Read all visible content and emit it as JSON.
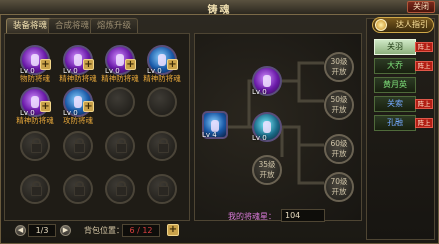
{
  "window": {
    "title": "铸魂",
    "close_label": "关闭"
  },
  "tabs": [
    "装备将魂",
    "合成将魂",
    "熔炼升级"
  ],
  "inventory": {
    "orbs": [
      {
        "level": "Lv 0",
        "label": "物防将魂",
        "color": "purple"
      },
      {
        "level": "Lv 0",
        "label": "精神防将魂",
        "color": "purple"
      },
      {
        "level": "Lv 0",
        "label": "精神防将魂",
        "color": "purple"
      },
      {
        "level": "Lv 0",
        "label": "精神防将魂",
        "color": "blue"
      },
      {
        "level": "Lv 0",
        "label": "精神防将魂",
        "color": "purple"
      },
      {
        "level": "Lv 0",
        "label": "攻防将魂",
        "color": "blue"
      }
    ],
    "page": "1/3",
    "bag_label": "背包位置：",
    "bag_value": "6 / 12",
    "prev_icon": "left-arrow-icon",
    "next_icon": "right-arrow-icon"
  },
  "tree": {
    "root_level": "Lv 4",
    "upper_level": "Lv 0",
    "lower_level": "Lv 0",
    "nodes": [
      {
        "level": "30级",
        "text": "开放"
      },
      {
        "level": "50级",
        "text": "开放"
      },
      {
        "level": "35级",
        "text": "开放"
      },
      {
        "level": "60级",
        "text": "开放"
      },
      {
        "level": "70级",
        "text": "开放"
      }
    ],
    "score_label": "我的将魂星：",
    "score_value": "104"
  },
  "sidebar": {
    "helper_label": "达人指引",
    "items": [
      {
        "label": "关羽",
        "badge": "阵上",
        "active": true
      },
      {
        "label": "大乔",
        "badge": "阵上",
        "active": false
      },
      {
        "label": "黄月英",
        "badge": "",
        "active": false
      },
      {
        "label": "关索",
        "badge": "阵上",
        "active": false
      },
      {
        "label": "孔融",
        "badge": "阵上",
        "active": false
      }
    ]
  },
  "colors": {
    "accent_gold": "#c9a24a",
    "text_orange": "#e8a83a",
    "badge_red": "#b21e14",
    "score_pink": "#d87ad8"
  }
}
